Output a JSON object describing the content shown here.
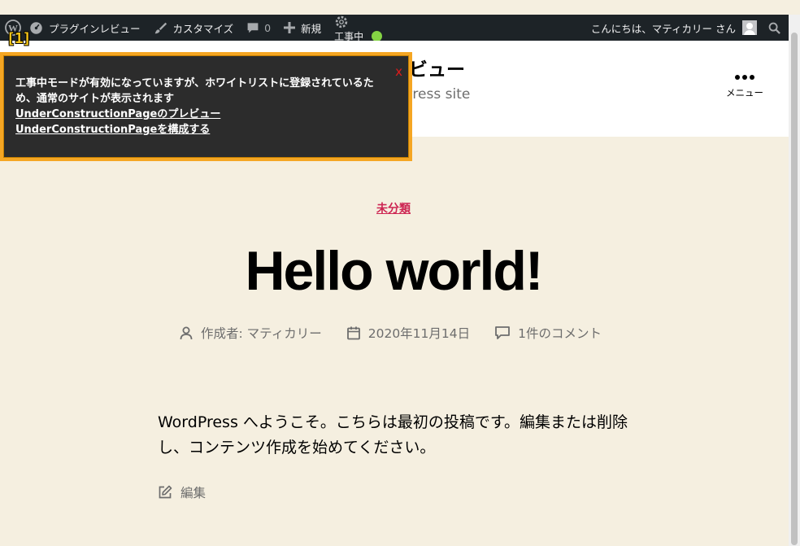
{
  "adminbar": {
    "site_name": "プラグインレビュー",
    "customize": "カスタマイズ",
    "comments_count": "0",
    "new": "新規",
    "under_construction": "工事中",
    "greeting": "こんにちは、マティカリー さん"
  },
  "header": {
    "site_title": "レビュー",
    "site_description": "rdPress site",
    "menu_label": "メニュー"
  },
  "notice": {
    "marker": "[1]",
    "message": "工事中モードが有効になっていますが、ホワイトリストに登録されているため、通常のサイトが表示されます",
    "preview_link": "UnderConstructionPageのプレビュー",
    "configure_link": "UnderConstructionPageを構成する",
    "close": "x"
  },
  "post": {
    "category": "未分類",
    "title": "Hello world!",
    "author": "作成者: マティカリー",
    "date": "2020年11月14日",
    "comments": "1件のコメント",
    "content": "WordPress へようこそ。こちらは最初の投稿です。編集または削除し、コンテンツ作成を始めてください。",
    "edit": "編集"
  },
  "colors": {
    "background": "#f5efe0",
    "adminbar": "#1d2327",
    "accent": "#cd2653",
    "notice_border": "#f5a623",
    "status_dot": "#84d344"
  }
}
